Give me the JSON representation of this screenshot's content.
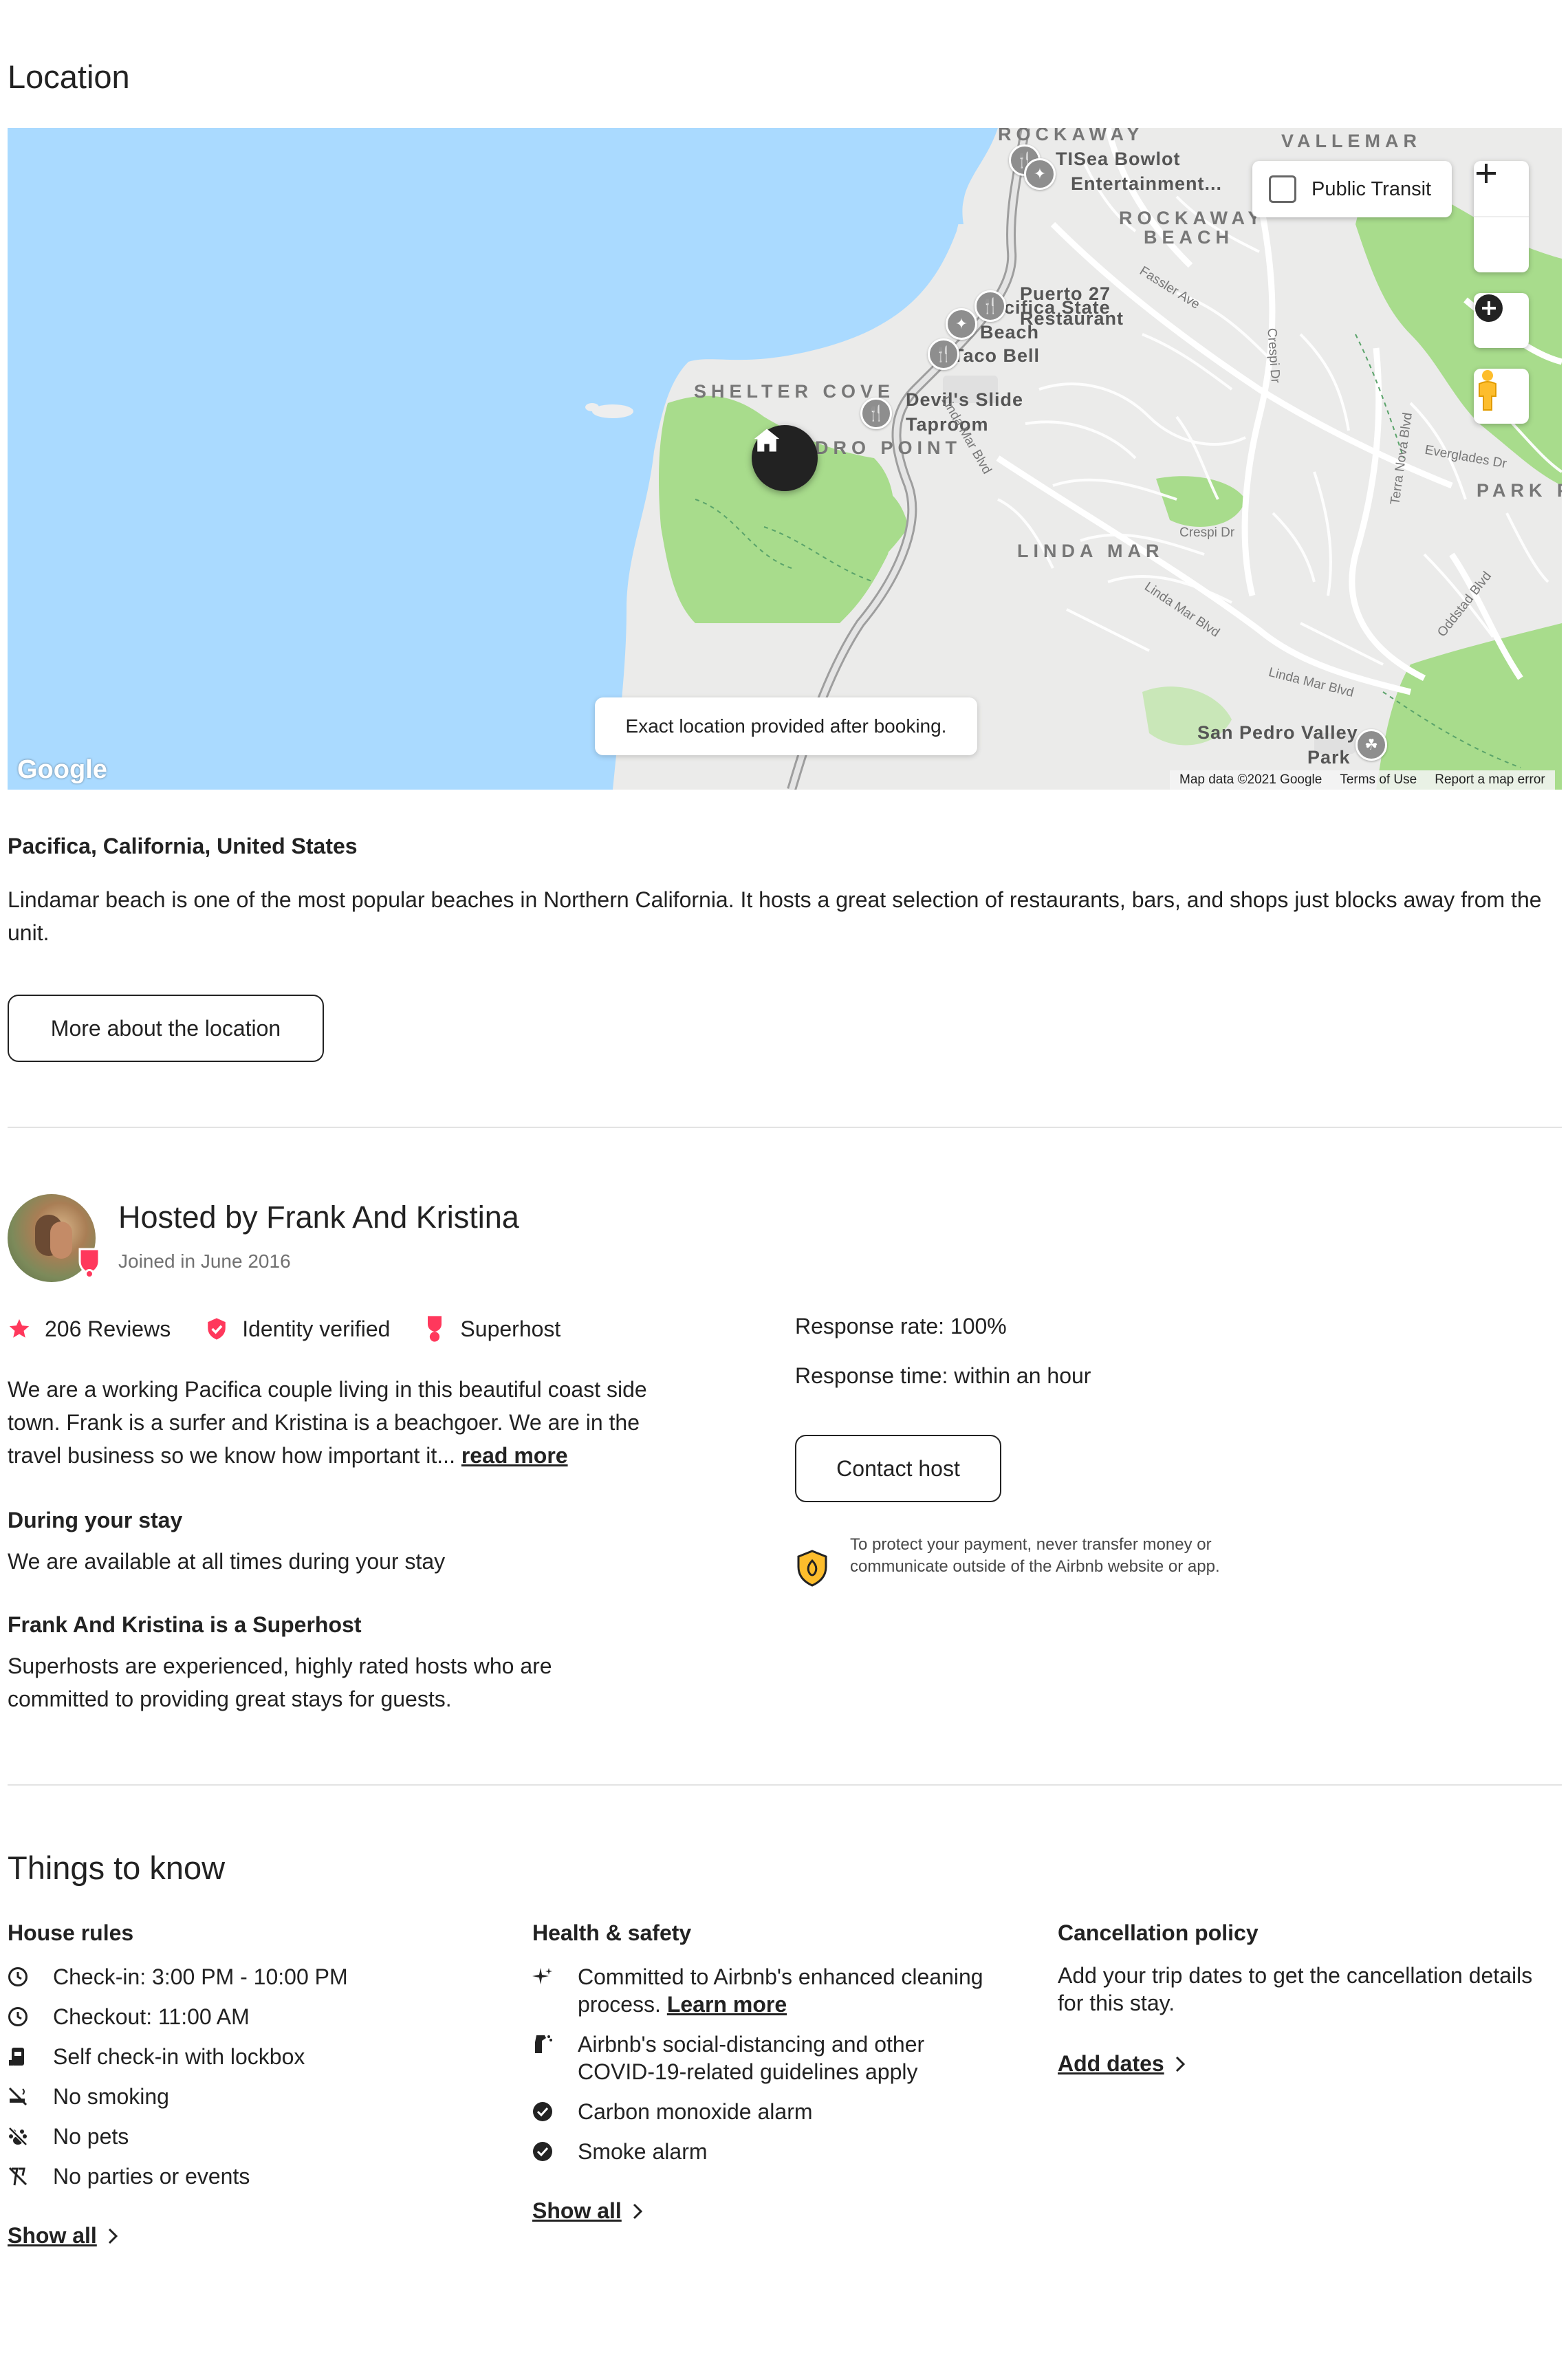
{
  "location": {
    "title": "Location",
    "map": {
      "labels": {
        "rockaway": "ROCKAWAY",
        "vallemar": "VALLEMAR",
        "rockaway_beach": "ROCKAWAY",
        "rockaway_beach2": "BEACH",
        "shelter_cove": "SHELTER COVE",
        "pedro_point": "DRO POINT",
        "linda_mar": "LINDA MAR",
        "park_p": "PARK P",
        "sea_bowl": "Sea Bowl",
        "sea_bowl_ent": "Entertainment...",
        "tsb": "TI",
        "sea_bowl_suffix": "ot",
        "puerto27": "Puerto 27",
        "restaurant": "Restaurant",
        "pacifica_state": "Pacifica State",
        "pacifica_beach": "Beach",
        "taco_bell": "Taco Bell",
        "devils_slide": "Devil's Slide",
        "taproom": "Taproom",
        "san_pedro_valley": "San Pedro Valley",
        "san_pedro_park": "Park",
        "fassler": "Fassler Ave",
        "crespi1": "Crespi Dr",
        "crespi2": "Crespi Dr",
        "terra_nova": "Terra Nova Blvd",
        "evergades": "Everglades Dr",
        "oddstad": "Oddstad Blvd",
        "linda_mar_blvd1": "Linda Mar Blvd",
        "linda_mar_blvd2": "Linda Mar Blvd",
        "linda_mar_blvd3": "Linda Mar Blvd",
        "dr": "Dr",
        "a": "Linda Mar Blvd"
      },
      "public_transit": "Public Transit",
      "notice": "Exact location provided after booking.",
      "google": "Google",
      "map_data": "Map data ©2021 Google",
      "terms": "Terms of Use",
      "report": "Report a map error",
      "icons": {
        "zoom_in": "plus-icon",
        "zoom_out": "minus-icon",
        "compass": "compass-icon",
        "pegman": "street-view-icon",
        "home": "home-icon"
      }
    },
    "place": "Pacifica, California, United States",
    "description": "Lindamar beach is one of the most popular beaches in Northern California. It hosts a great selection of restaurants, bars, and shops just blocks away from the unit.",
    "more_button": "More about the location"
  },
  "host": {
    "title": "Hosted by Frank And Kristina",
    "joined": "Joined in June 2016",
    "reviews": "206 Reviews",
    "identity": "Identity verified",
    "superhost": "Superhost",
    "bio": "We are a working Pacifica couple living in this beautiful coast side town. Frank is a surfer and Kristina is a beachgoer. We are in the travel business so we know how important it...",
    "read_more": "read more",
    "during_title": "During your stay",
    "during_text": "We are available at all times during your stay",
    "superhost_title": "Frank And Kristina is a Superhost",
    "superhost_text": "Superhosts are experienced, highly rated hosts who are committed to providing great stays for guests.",
    "response_rate": "Response rate: 100%",
    "response_time": "Response time: within an hour",
    "contact_button": "Contact host",
    "protect_text": "To protect your payment, never transfer money or communicate outside of the Airbnb website or app.",
    "accent_color": "#FF385C"
  },
  "things": {
    "title": "Things to know",
    "house_rules": {
      "title": "House rules",
      "items": [
        {
          "icon": "clock-icon",
          "text": "Check-in: 3:00 PM - 10:00 PM"
        },
        {
          "icon": "clock-icon",
          "text": "Checkout: 11:00 AM"
        },
        {
          "icon": "lockbox-icon",
          "text": "Self check-in with lockbox"
        },
        {
          "icon": "no-smoking-icon",
          "text": "No smoking"
        },
        {
          "icon": "no-pets-icon",
          "text": "No pets"
        },
        {
          "icon": "no-parties-icon",
          "text": "No parties or events"
        }
      ],
      "show_all": "Show all"
    },
    "health": {
      "title": "Health & safety",
      "item1": "Committed to Airbnb's enhanced cleaning process.",
      "item1_link": "Learn more",
      "item2": "Airbnb's social-distancing and other COVID-19-related guidelines apply",
      "item3": "Carbon monoxide alarm",
      "item4": "Smoke alarm",
      "show_all": "Show all"
    },
    "cancellation": {
      "title": "Cancellation policy",
      "text": "Add your trip dates to get the cancellation details for this stay.",
      "link": "Add dates"
    }
  }
}
